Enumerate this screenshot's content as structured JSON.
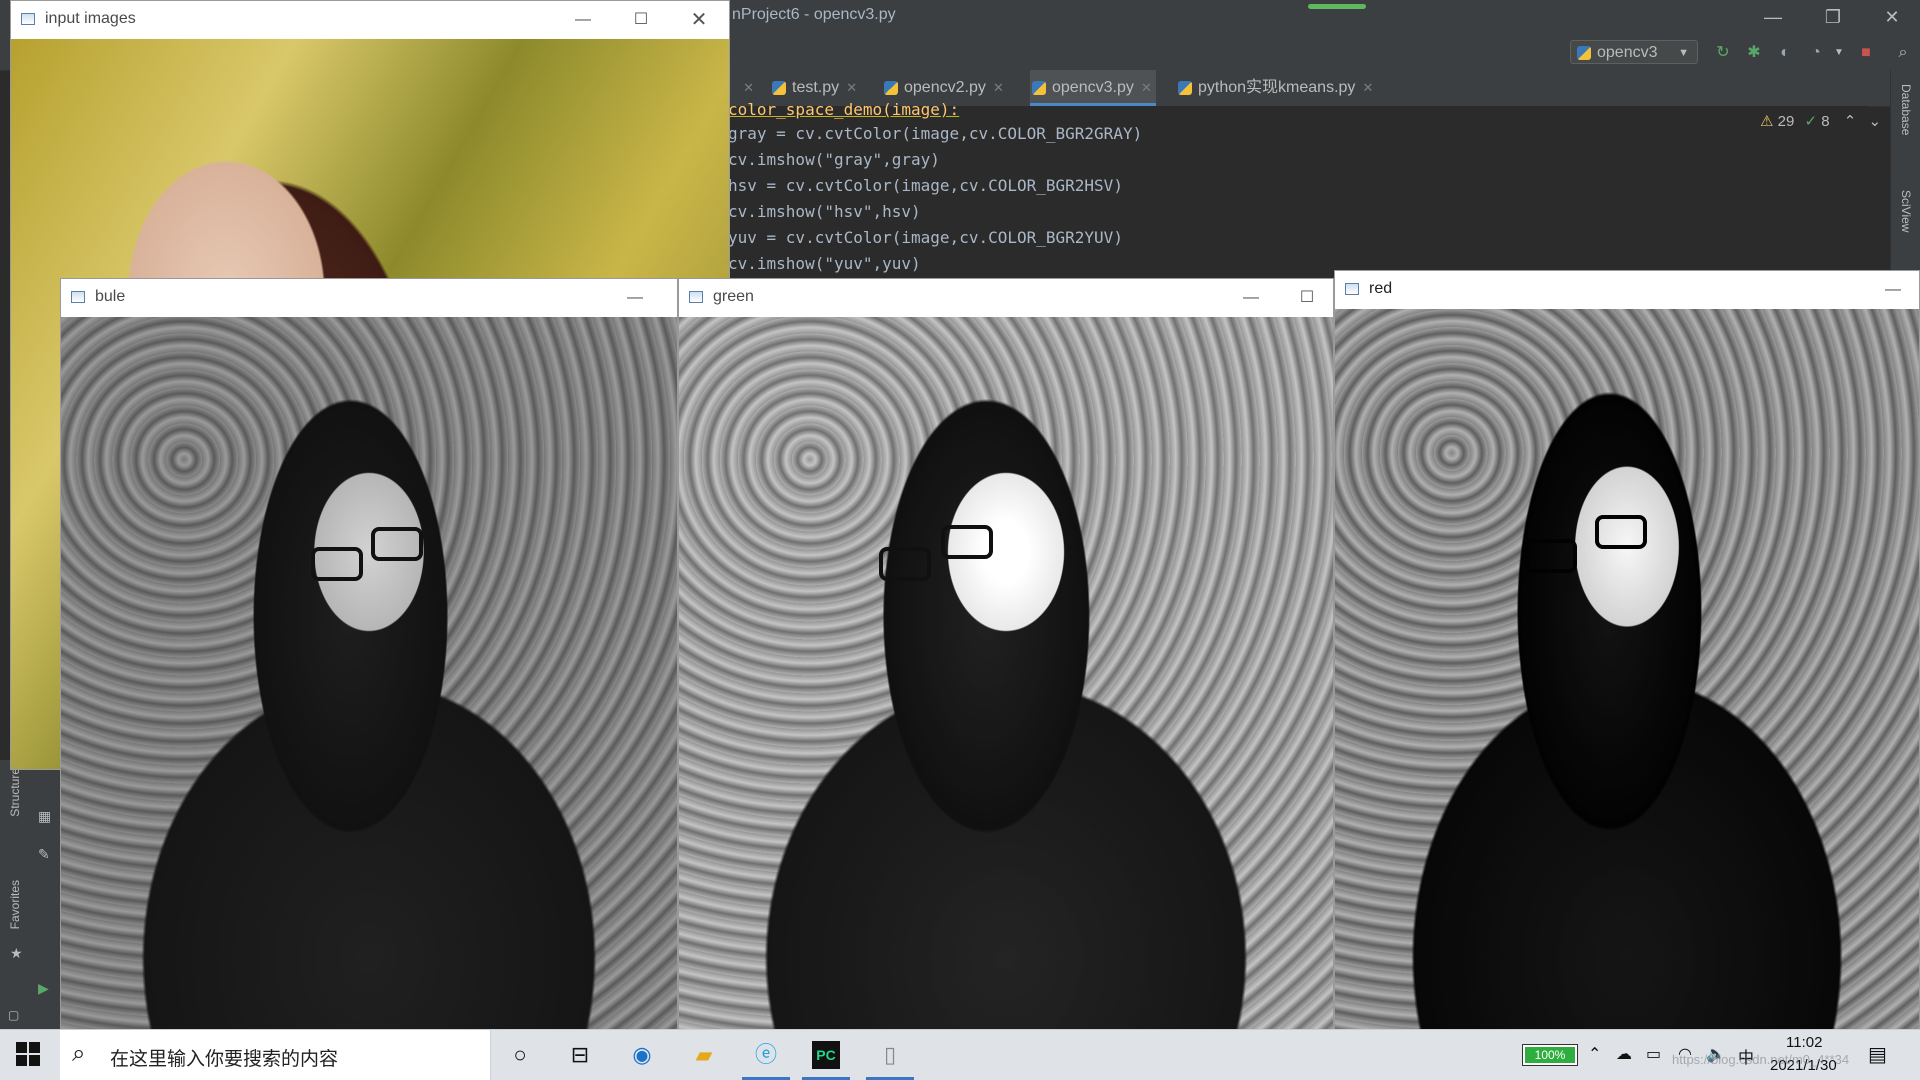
{
  "ide": {
    "title": "nProject6 - opencv3.py",
    "progress": 1.0,
    "run_config": "opencv3",
    "tabs": [
      {
        "label": "test.py"
      },
      {
        "label": "opencv2.py"
      },
      {
        "label": "opencv3.py"
      },
      {
        "label": "python实现kmeans.py"
      }
    ],
    "code_lines": [
      "color_space_demo(image):",
      "gray = cv.cvtColor(image,cv.COLOR_BGR2GRAY)",
      "cv.imshow(\"gray\",gray)",
      "hsv = cv.cvtColor(image,cv.COLOR_BGR2HSV)",
      "cv.imshow(\"hsv\",hsv)",
      "yuv = cv.cvtColor(image,cv.COLOR_BGR2YUV)",
      "cv.imshow(\"yuv\",yuv)"
    ],
    "warnings": "29",
    "ok_count": "8",
    "right_strip": {
      "database": "Database",
      "sciview": "SciView"
    },
    "left_strip": {
      "structure": "Structure",
      "favorites": "Favorites"
    }
  },
  "windows": {
    "input": {
      "title": "input images"
    },
    "blue": {
      "title": "bule"
    },
    "green": {
      "title": "green"
    },
    "red": {
      "title": "red"
    }
  },
  "taskbar": {
    "search_placeholder": "在这里输入你要搜索的内容",
    "battery": "100%",
    "ime": "中",
    "time": "11:02",
    "date": "2021/1/30",
    "watermark": "https://blog.csdn.net/m0_4**34"
  },
  "colors": {
    "ide_bg": "#2b2b2b",
    "accent": "#4a88c7",
    "taskbar": "#dfe3e8"
  }
}
